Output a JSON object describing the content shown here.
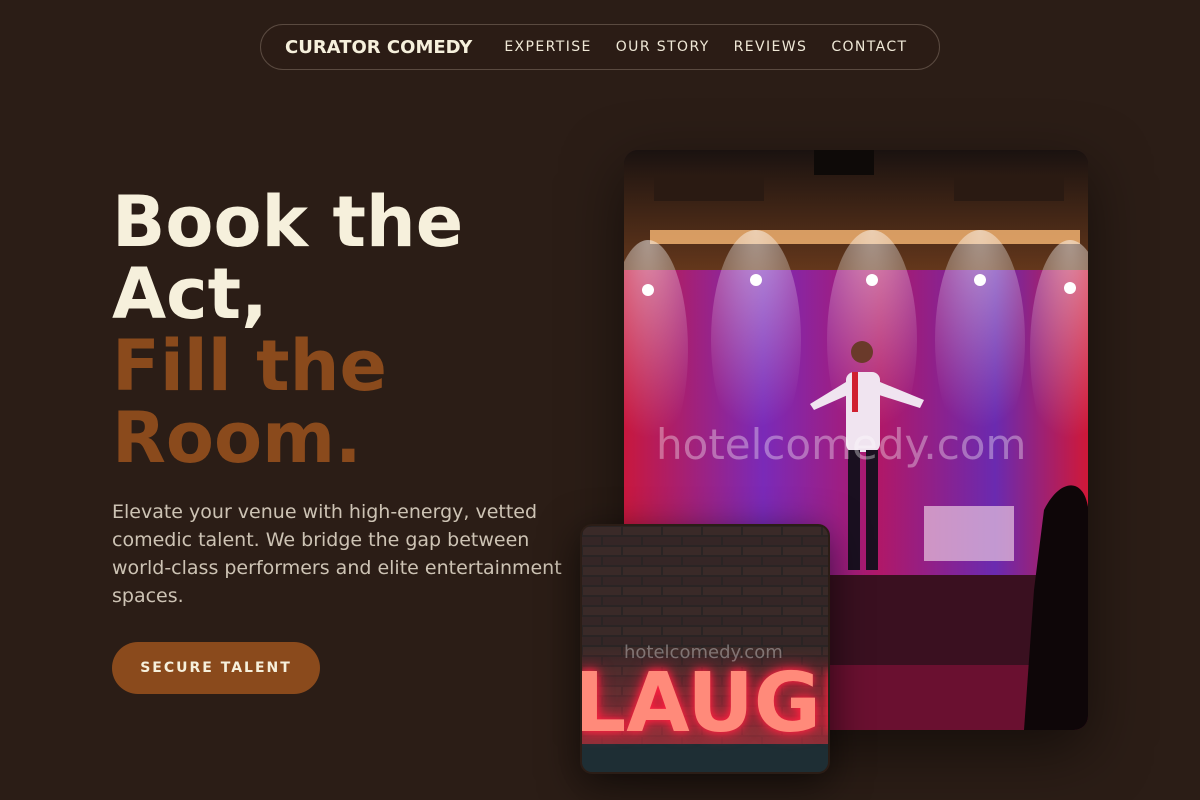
{
  "nav": {
    "brand": "CURATOR COMEDY",
    "links": [
      "EXPERTISE",
      "OUR STORY",
      "REVIEWS",
      "CONTACT"
    ]
  },
  "hero": {
    "title_line1": "Book the",
    "title_line2": "Act,",
    "title_accent1": "Fill the",
    "title_accent2": "Room.",
    "description": "Elevate your venue with high-energy, vetted comedic talent. We bridge the gap between world-class performers and elite entertainment spaces.",
    "cta_label": "SECURE TALENT"
  },
  "images": {
    "stage_watermark": "hotelcomedy.com",
    "laugh_watermark": "hotelcomedy.com",
    "laugh_sign": "LAUGH"
  },
  "colors": {
    "background": "#2b1d16",
    "cream": "#f6f0dc",
    "accent": "#8a4a1c"
  }
}
